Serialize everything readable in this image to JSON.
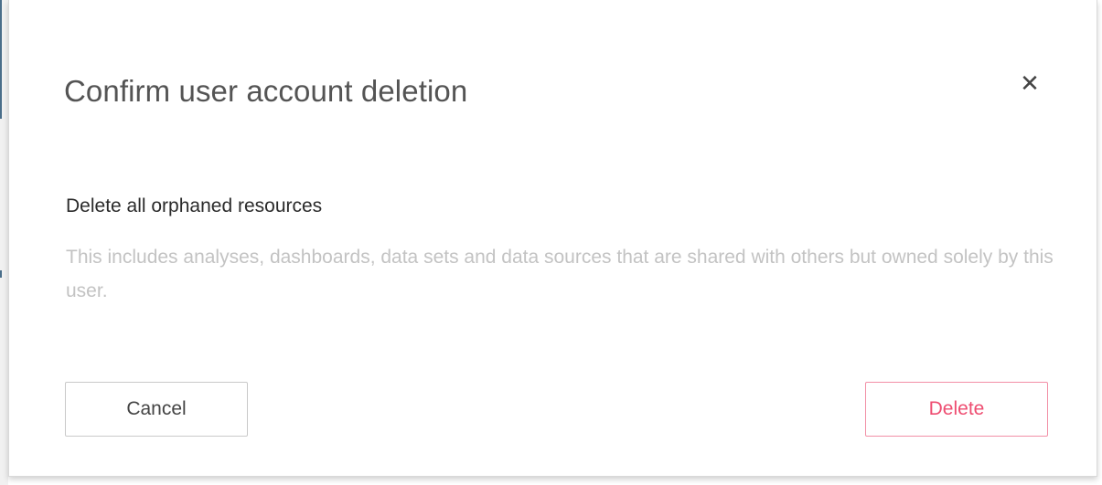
{
  "dialog": {
    "title": "Confirm user account deletion",
    "close_icon": "close-icon",
    "close_glyph": "✕",
    "option": {
      "title": "Delete all orphaned resources",
      "description": "This includes analyses, dashboards, data sets and data sources that are shared with others but owned solely by this user."
    },
    "buttons": {
      "cancel_label": "Cancel",
      "delete_label": "Delete"
    }
  },
  "colors": {
    "title_text": "#545454",
    "description_text": "#c3c3c3",
    "delete_accent": "#ee4d71",
    "delete_border": "#f28fa6",
    "cancel_border": "#c9c9c9"
  }
}
